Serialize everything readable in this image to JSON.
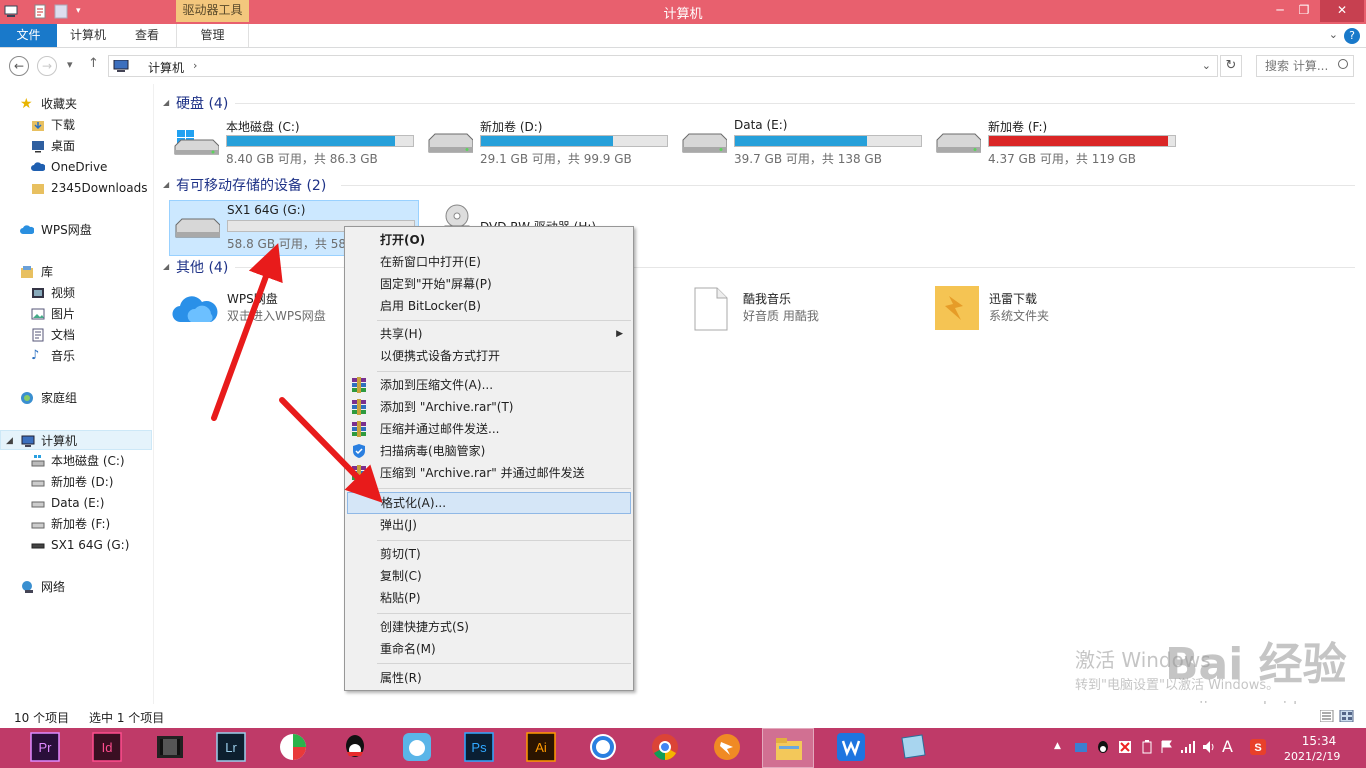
{
  "window": {
    "title": "计算机",
    "context_tab_group": "驱动器工具",
    "controls": {
      "minimize": "─",
      "maximize": "❐",
      "close": "✕"
    }
  },
  "ribbon": {
    "tabs": [
      {
        "label": "文件"
      },
      {
        "label": "计算机"
      },
      {
        "label": "查看"
      },
      {
        "label": "管理"
      }
    ],
    "help": "?"
  },
  "address": {
    "back": "←",
    "forward": "→",
    "up": "↑",
    "recent": "▾",
    "crumbs": [
      "计算机"
    ],
    "crumb_sep": "›",
    "dropdown": "⌄",
    "refresh": "↻",
    "search_placeholder": "搜索 计算..."
  },
  "nav": {
    "favorites": "收藏夹",
    "fav_items": [
      "下载",
      "桌面",
      "OneDrive",
      "2345Downloads"
    ],
    "wps": "WPS网盘",
    "libraries": "库",
    "lib_items": [
      "视频",
      "图片",
      "文档",
      "音乐"
    ],
    "homegroup": "家庭组",
    "computer": "计算机",
    "drives": [
      "本地磁盘 (C:)",
      "新加卷 (D:)",
      "Data (E:)",
      "新加卷 (F:)",
      "SX1 64G (G:)"
    ],
    "network": "网络"
  },
  "content": {
    "hard_disks_header": "硬盘 (4)",
    "hard_disks": [
      {
        "name": "本地磁盘 (C:)",
        "info": "8.40 GB 可用，共 86.3 GB",
        "used_fraction": 0.903
      },
      {
        "name": "新加卷 (D:)",
        "info": "29.1 GB 可用，共 99.9 GB",
        "used_fraction": 0.709
      },
      {
        "name": "Data (E:)",
        "info": "39.7 GB 可用，共 138 GB",
        "used_fraction": 0.712
      },
      {
        "name": "新加卷 (F:)",
        "info": "4.37 GB 可用，共 119 GB",
        "used_fraction": 0.963
      }
    ],
    "removable_header": "有可移动存储的设备 (2)",
    "removable": [
      {
        "name": "SX1 64G (G:)",
        "info": "58.8 GB 可用，共 58.",
        "used_fraction": 0.0
      },
      {
        "name": "DVD RW 驱动器 (H:)"
      }
    ],
    "other_header": "其他 (4)",
    "other": [
      {
        "name": "WPS网盘",
        "sub": "双击进入WPS网盘"
      },
      {
        "name": "酷我音乐",
        "sub": "好音质 用酷我"
      },
      {
        "name": "迅雷下载",
        "sub": "系统文件夹"
      }
    ],
    "group_chevron": "◢"
  },
  "status": {
    "items": "10 个项目",
    "selected": "选中 1 个项目"
  },
  "context_menu": {
    "items": [
      {
        "label": "打开(O)"
      },
      {
        "label": "在新窗口中打开(E)"
      },
      {
        "label": "固定到\"开始\"屏幕(P)"
      },
      {
        "label": "启用 BitLocker(B)"
      },
      {
        "label": "共享(H)"
      },
      {
        "label": "以便携式设备方式打开"
      },
      {
        "label": "添加到压缩文件(A)..."
      },
      {
        "label": "添加到 \"Archive.rar\"(T)"
      },
      {
        "label": "压缩并通过邮件发送..."
      },
      {
        "label": "扫描病毒(电脑管家)"
      },
      {
        "label": "压缩到 \"Archive.rar\" 并通过邮件发送"
      },
      {
        "label": "格式化(A)..."
      },
      {
        "label": "弹出(J)"
      },
      {
        "label": "剪切(T)"
      },
      {
        "label": "复制(C)"
      },
      {
        "label": "粘贴(P)"
      },
      {
        "label": "创建快捷方式(S)"
      },
      {
        "label": "重命名(M)"
      },
      {
        "label": "属性(R)"
      }
    ],
    "submenu_arrow": "▶"
  },
  "taskbar": {
    "apps": [
      "Pr",
      "Id",
      "Lr",
      "Ps",
      "Ai"
    ],
    "clock_time": "15:34",
    "clock_date": "2021/2/19",
    "ime": "A"
  },
  "watermark": {
    "activate": "激活 Windows",
    "activate_sub": "转到\"电脑设置\"以激活 Windows。",
    "brand": "Bai 经验",
    "url": "jingyan.baidu.com"
  },
  "colors": {
    "titlebar": "#e8606e",
    "taskbar": "#bf3a68",
    "accent": "#1979ca",
    "bar_normal": "#26a0da",
    "bar_full": "#da2626",
    "arrow": "#e81b1b"
  }
}
